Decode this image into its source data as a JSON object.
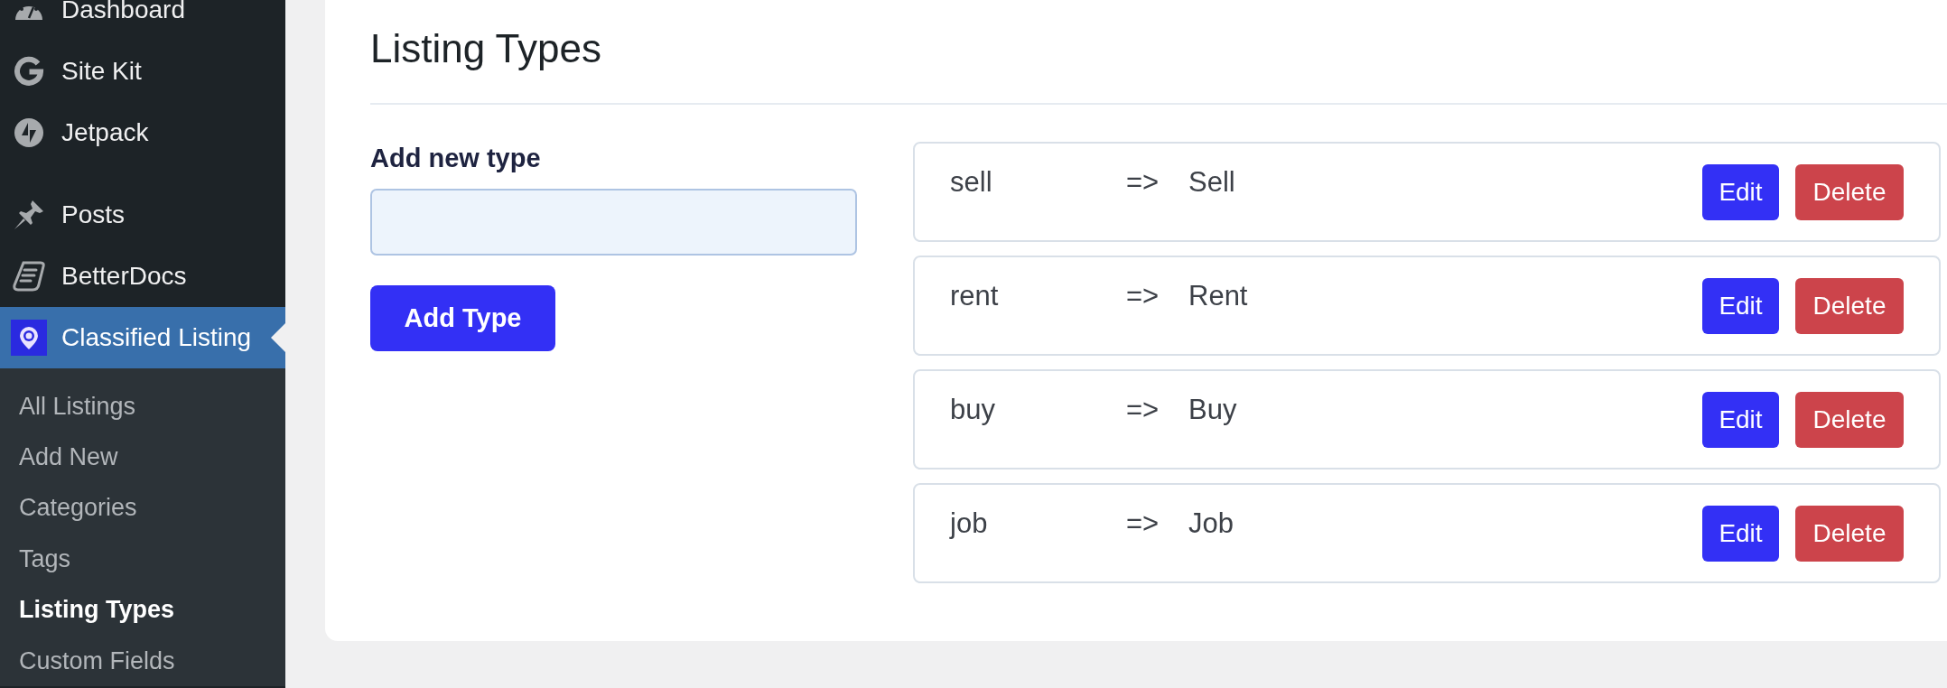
{
  "sidebar": {
    "menu_groups": [
      {
        "items": [
          {
            "label": "Dashboard",
            "selected": false
          },
          {
            "label": "Site Kit",
            "selected": false
          },
          {
            "label": "Jetpack",
            "selected": false
          }
        ]
      },
      {
        "items": [
          {
            "label": "Posts",
            "selected": false
          },
          {
            "label": "BetterDocs",
            "selected": false
          },
          {
            "label": "Classified Listing",
            "selected": true
          }
        ]
      }
    ],
    "submenu": [
      {
        "label": "All Listings",
        "selected": false
      },
      {
        "label": "Add New",
        "selected": false
      },
      {
        "label": "Categories",
        "selected": false
      },
      {
        "label": "Tags",
        "selected": false
      },
      {
        "label": "Listing Types",
        "selected": true
      },
      {
        "label": "Custom Fields",
        "selected": false
      }
    ]
  },
  "page": {
    "title": "Listing Types"
  },
  "add_form": {
    "label": "Add new type",
    "button": "Add Type"
  },
  "types": [
    {
      "slug": "sell",
      "arrow": "=>",
      "name": "Sell",
      "edit_button": "Edit",
      "delete_button": "Delete"
    },
    {
      "slug": "rent",
      "arrow": "=>",
      "name": "Rent",
      "edit_button": "Edit",
      "delete_button": "Delete"
    },
    {
      "slug": "buy",
      "arrow": "=>",
      "name": "Buy",
      "edit_button": "Edit",
      "delete_button": "Delete"
    },
    {
      "slug": "job",
      "arrow": "=>",
      "name": "Job",
      "edit_button": "Edit",
      "delete_button": "Delete"
    }
  ]
}
